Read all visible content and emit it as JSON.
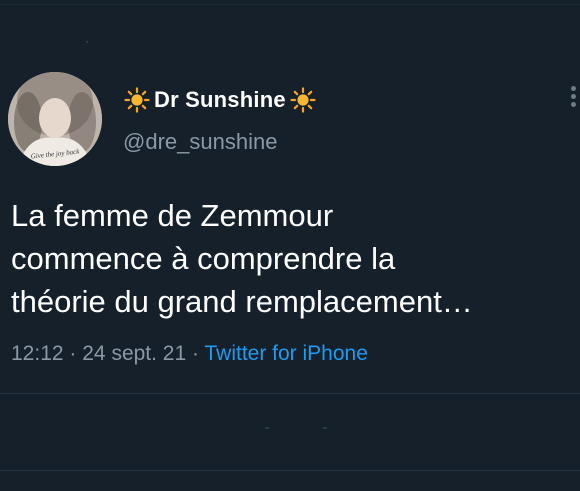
{
  "tweet": {
    "avatar_caption": "Give the joy back",
    "display_name": "Dr Sunshine",
    "handle": "@dre_sunshine",
    "text": "La femme de Zemmour\ncommence à comprendre la\nthéorie du grand remplacement…",
    "time": "12:12",
    "separator": "·",
    "date": "24 sept. 21",
    "source": "Twitter for iPhone"
  },
  "icons": {
    "name_prefix": "sun-icon",
    "name_suffix": "sun-icon",
    "more": "more-vertical-icon"
  },
  "colors": {
    "background": "#15202b",
    "text": "#ffffff",
    "secondary": "#8b98a5",
    "link": "#1d9bf0",
    "sun": "#f5a623"
  }
}
